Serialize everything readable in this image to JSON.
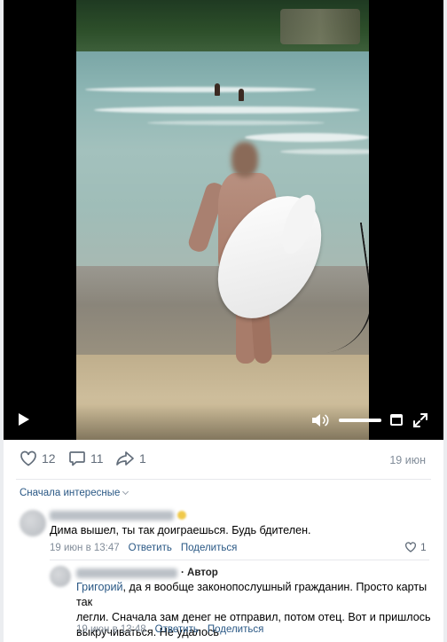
{
  "post": {
    "likes": "12",
    "comments": "11",
    "shares": "1",
    "date": "19 июн"
  },
  "video": {
    "volume_level": 1.0
  },
  "comments": {
    "sort_label": "Сначала интересные",
    "items": [
      {
        "text": "Дима вышел, ты так доиграешься. Будь бдителен.",
        "time": "19 июн в 13:47",
        "reply_label": "Ответить",
        "share_label": "Поделиться",
        "likes": "1"
      }
    ],
    "reply": {
      "badge": "· Автор",
      "mention": "Григорий",
      "text_line1": ", да я вообще законопослушный гражданин. Просто карты так",
      "text_line2": "легли. Сначала зам денег не отправил, потом отец. Вот и пришлось",
      "text_line3": "выкручиваться. Не удалось",
      "time": "19 июн в 13:48",
      "reply_label": "Ответить",
      "share_label": "Поделиться"
    }
  },
  "colors": {
    "link": "#2a5885",
    "muted": "#818c99",
    "icon": "#626d7a"
  }
}
